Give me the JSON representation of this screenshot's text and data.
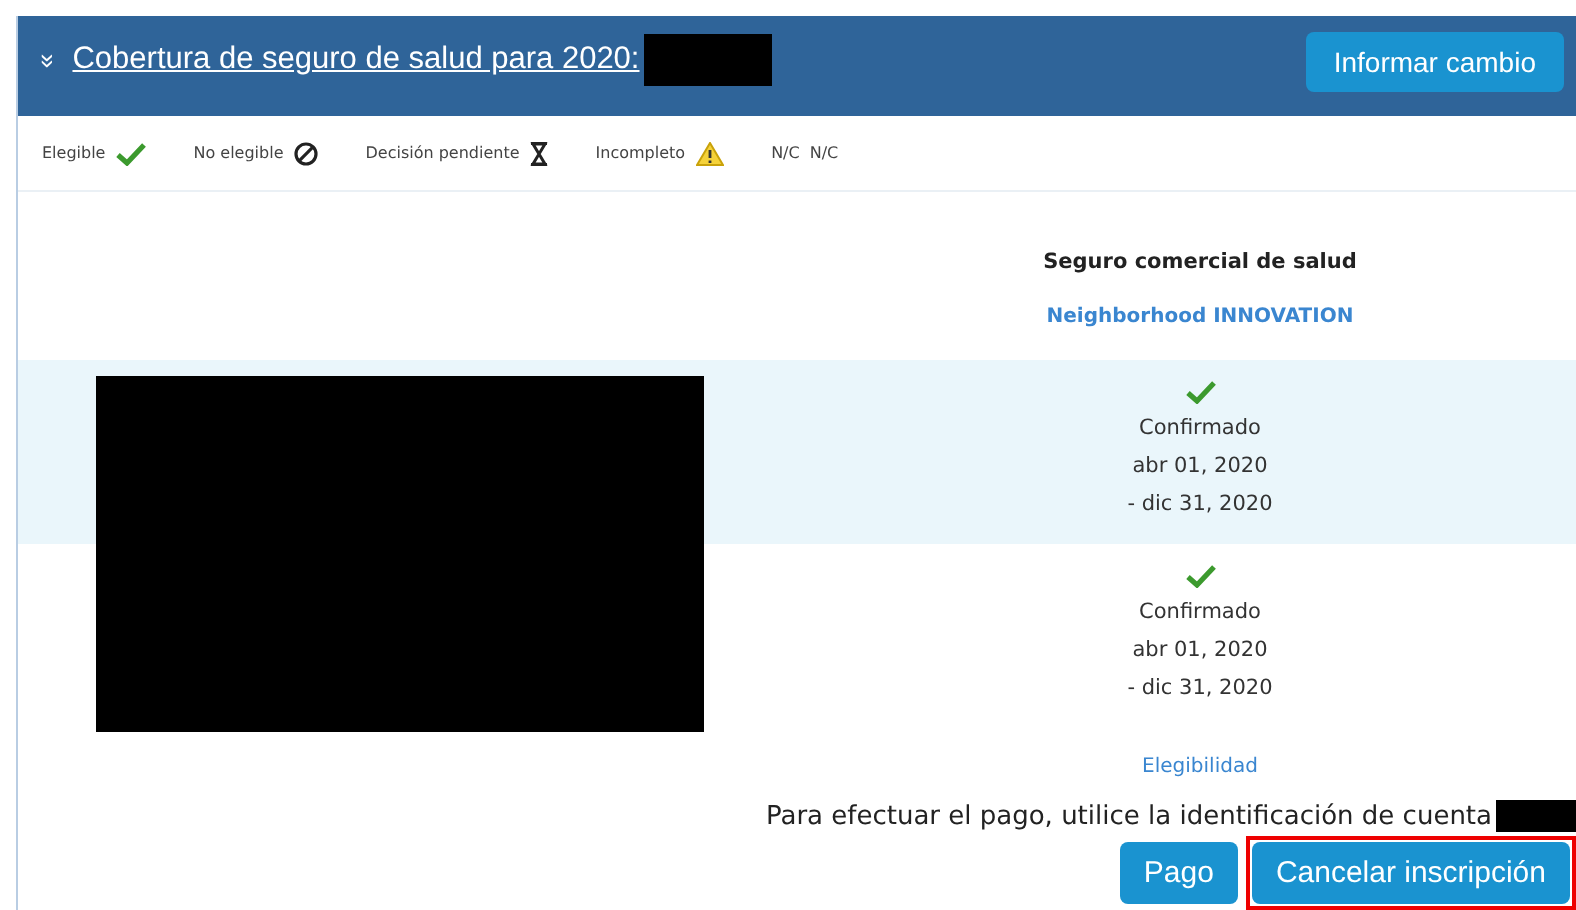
{
  "header": {
    "toggle": "»",
    "title": "Cobertura de seguro de salud para 2020:",
    "redacted": true,
    "button": "Informar cambio"
  },
  "legend": [
    {
      "label": "Elegible",
      "kind": "check"
    },
    {
      "label": "No elegible",
      "kind": "blocked"
    },
    {
      "label": "Decisión pendiente",
      "kind": "hourglass"
    },
    {
      "label": "Incompleto",
      "kind": "warning"
    },
    {
      "label": "N/C",
      "kind": "text",
      "symbol": "N/C"
    }
  ],
  "plan": {
    "type": "Seguro comercial de salud",
    "name": "Neighborhood INNOVATION"
  },
  "members": [
    {
      "redacted": true,
      "status": "Confirmado",
      "start": "abr 01, 2020",
      "end": "- dic 31, 2020",
      "kind": "check"
    },
    {
      "redacted": true,
      "status": "Confirmado",
      "start": "abr 01, 2020",
      "end": "- dic 31, 2020",
      "kind": "check"
    }
  ],
  "eligibility_link": "Elegibilidad",
  "payment_note": "Para efectuar el pago, utilice la identificación de cuenta",
  "payment_redacted": true,
  "buttons": [
    {
      "label": "Pago",
      "highlighted": false
    },
    {
      "label": "Cancelar inscripción",
      "highlighted": true
    }
  ]
}
